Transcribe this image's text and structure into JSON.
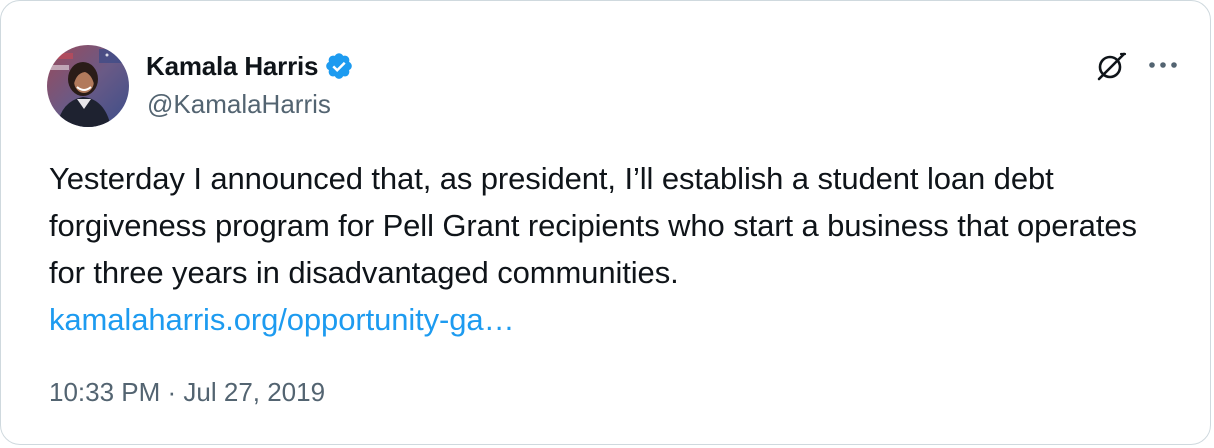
{
  "author": {
    "display_name": "Kamala Harris",
    "handle": "@KamalaHarris",
    "verified": true
  },
  "tweet": {
    "text": "Yesterday I announced that, as president, I’ll establish a student loan debt forgiveness program for Pell Grant recipients who start a business that operates for three years in disadvantaged communities.",
    "link": "kamalaharris.org/opportunity-ga…",
    "timestamp": "10:33 PM · Jul 27, 2019"
  },
  "colors": {
    "text": "#0f1419",
    "secondary": "#536471",
    "link": "#1d9bf0",
    "verified": "#1d9bf0",
    "border": "#cfd9de"
  },
  "icons": {
    "verified": "verified-badge-icon",
    "grok": "grok-icon",
    "more": "more-options-icon"
  }
}
